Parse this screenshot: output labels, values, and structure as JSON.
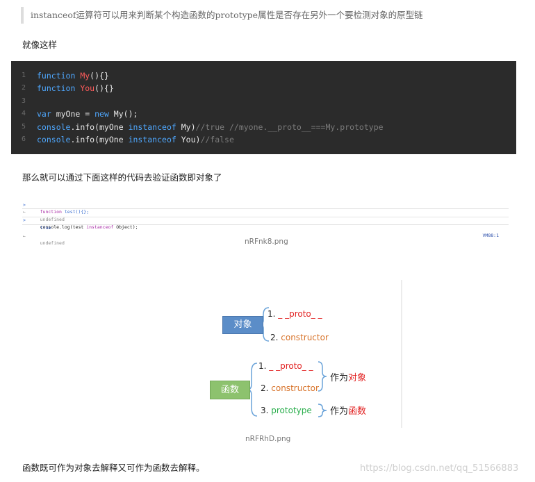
{
  "quote_text": "instanceof运算符可以用来判断某个构造函数的prototype属性是否存在另外一个要检测对象的原型链",
  "para_like_this": "就像这样",
  "code_lines": [
    {
      "no": "1",
      "t1": "function ",
      "t2": "My",
      "t3": "(){}"
    },
    {
      "no": "2",
      "t1": "function ",
      "t2": "You",
      "t3": "(){}"
    },
    {
      "no": "3"
    },
    {
      "no": "4",
      "t1": "var ",
      "t2": "myOne = ",
      "t3": "new ",
      "t4": "My();"
    },
    {
      "no": "5",
      "t1": "console",
      "t2": ".info(myOne ",
      "t3": "instanceof ",
      "t4": "My)",
      "t5": "//true //myone.__proto__===My.prototype"
    },
    {
      "no": "6",
      "t1": "console",
      "t2": ".info(myOne ",
      "t3": "instanceof ",
      "t4": "You)",
      "t5": "//false"
    }
  ],
  "para_verify": "那么就可以通过下面这样的代码去验证函数即对象了",
  "console": {
    "l1_prefix": ">",
    "l1_kw": "function ",
    "l1_rest": "test(){};",
    "l2_prefix": "←",
    "l2": "undefined",
    "l3_prefix": ">",
    "l3_a": "console.log(test ",
    "l3_kw": "instanceof ",
    "l3_b": "Object);",
    "l4": "true",
    "l4_src": "VM88:1",
    "l5_prefix": "←",
    "l5": "undefined"
  },
  "caption1": "nRFnk8.png",
  "diagram": {
    "box_object": "对象",
    "box_function": "函数",
    "obj_item1_num": "1. ",
    "obj_item1": "_ _proto_ _",
    "obj_item2_num": "2. ",
    "obj_item2": "constructor",
    "fn_item1_num": "1. ",
    "fn_item1": "_ _proto_ _",
    "fn_item2_num": "2. ",
    "fn_item2": "constructor",
    "fn_item3_num": "3. ",
    "fn_item3": "prototype",
    "as_label_1": "作为",
    "as_object": "对象",
    "as_label_2": "作为",
    "as_function": "函数"
  },
  "caption2": "nRFRhD.png",
  "para_conclusion": "函数既可作为对象去解释又可作为函数去解释。",
  "watermark": "https://blog.csdn.net/qq_51566883",
  "colors": {
    "code_bg": "#2b2b2b",
    "keyword": "#4fa8ff",
    "function_name": "#ff5b5b",
    "comment": "#7b7b7b",
    "proto_red": "#e22020",
    "constructor_orange": "#d8732a",
    "prototype_green": "#2aae4c",
    "box_blue": "#5b8dc8",
    "box_green": "#8dc26e"
  }
}
